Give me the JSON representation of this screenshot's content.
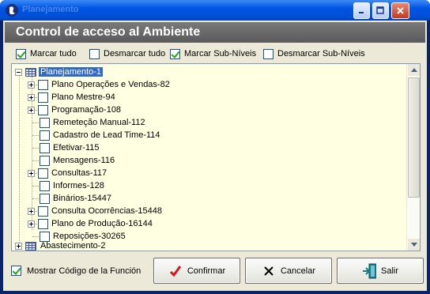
{
  "window": {
    "ghost_title": "Planejamento",
    "colors": {
      "titlebar": "#0054e3",
      "header_band": "#6b6b6b",
      "tree_bg": "#ffffe1",
      "selection": "#316ac5"
    }
  },
  "header": {
    "title": "Control de acceso al Ambiente"
  },
  "options": {
    "mark_all": {
      "label": "Marcar tudo",
      "checked": true
    },
    "unmark_all": {
      "label": "Desmarcar tudo",
      "checked": false
    },
    "mark_sub": {
      "label": "Marcar Sub-Níveis",
      "checked": true
    },
    "unmark_sub": {
      "label": "Desmarcar Sub-Níveis",
      "checked": false
    }
  },
  "tree": {
    "root": {
      "label": "Planejamento-1",
      "icon": "grid-icon",
      "expanded": true
    },
    "children": [
      {
        "label": "Plano Operações e Vendas-82",
        "expandable": true,
        "checked": false
      },
      {
        "label": "Plano Mestre-94",
        "expandable": true,
        "checked": false
      },
      {
        "label": "Programação-108",
        "expandable": true,
        "checked": false
      },
      {
        "label": "Remeteção Manual-112",
        "expandable": false,
        "checked": false
      },
      {
        "label": "Cadastro de Lead Time-114",
        "expandable": false,
        "checked": false
      },
      {
        "label": "Efetivar-115",
        "expandable": false,
        "checked": false
      },
      {
        "label": "Mensagens-116",
        "expandable": false,
        "checked": false
      },
      {
        "label": "Consultas-117",
        "expandable": true,
        "checked": false
      },
      {
        "label": "Informes-128",
        "expandable": false,
        "checked": false
      },
      {
        "label": "Binários-15447",
        "expandable": false,
        "checked": false
      },
      {
        "label": "Consulta Ocorrências-15448",
        "expandable": true,
        "checked": false
      },
      {
        "label": "Plano de Produção-16144",
        "expandable": true,
        "checked": false
      },
      {
        "label": "Reposições-30265",
        "expandable": false,
        "checked": false
      }
    ],
    "next_root": {
      "label": "Abastecimento-2",
      "icon": "grid-icon",
      "expanded": false
    }
  },
  "footer": {
    "show_code": {
      "label": "Mostrar Código de la Función",
      "checked": true
    },
    "confirm": "Confirmar",
    "cancel": "Cancelar",
    "exit": "Salir"
  }
}
